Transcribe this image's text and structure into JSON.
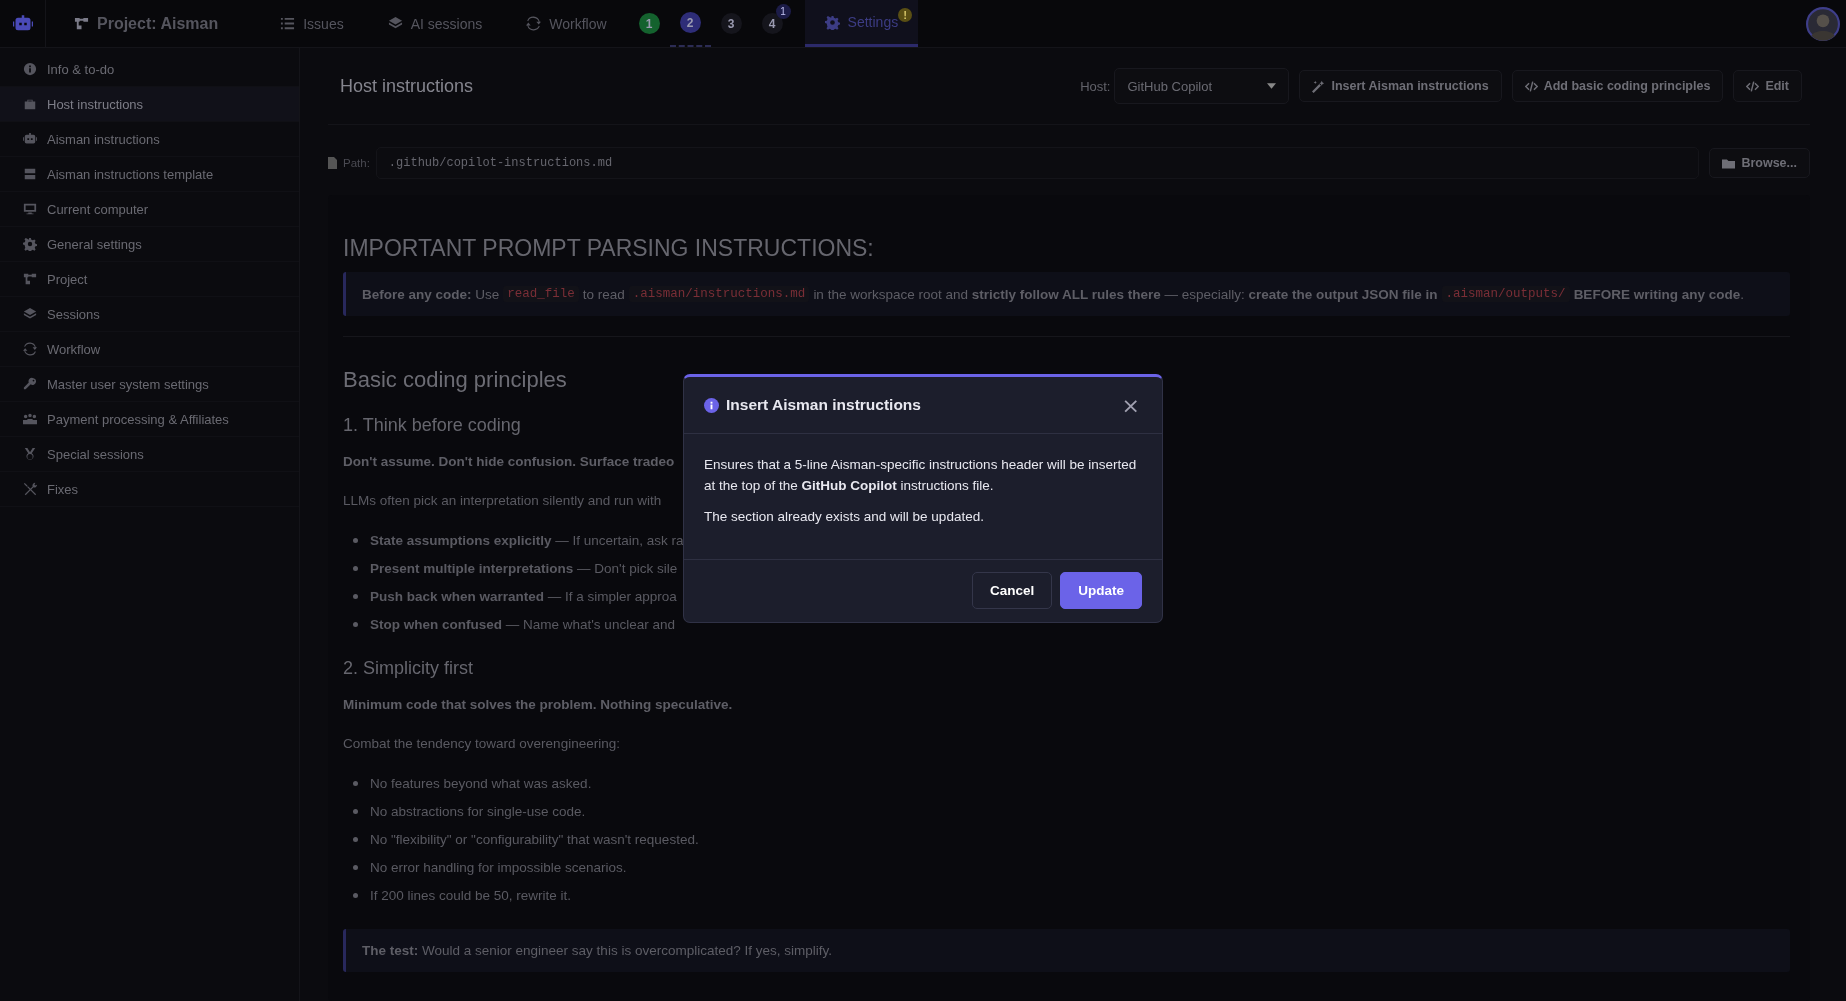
{
  "topbar": {
    "project": "Project: Aisman",
    "tabs": [
      {
        "kind": "tab",
        "label": "Issues",
        "selected": false
      },
      {
        "kind": "tab",
        "label": "AI sessions",
        "selected": false
      },
      {
        "kind": "tab",
        "label": "Workflow",
        "selected": false
      },
      {
        "kind": "slot",
        "label": "1",
        "color": "#14622e",
        "active": false
      },
      {
        "kind": "slot",
        "label": "2",
        "color": "#2e2d78",
        "active": true
      },
      {
        "kind": "slot",
        "label": "3",
        "color": "#15151c",
        "active": false
      },
      {
        "kind": "slot",
        "label": "4",
        "color": "#15151c",
        "active": false,
        "badge": "1"
      },
      {
        "kind": "tab",
        "label": "Settings",
        "selected": true,
        "badge": "!"
      }
    ]
  },
  "sidebar": {
    "items": [
      {
        "label": "Info & to-do",
        "selected": false
      },
      {
        "label": "Host instructions",
        "selected": true
      },
      {
        "label": "Aisman instructions",
        "selected": false
      },
      {
        "label": "Aisman instructions template",
        "selected": false
      },
      {
        "label": "Current computer",
        "selected": false
      },
      {
        "label": "General settings",
        "selected": false
      },
      {
        "label": "Project",
        "selected": false
      },
      {
        "label": "Sessions",
        "selected": false
      },
      {
        "label": "Workflow",
        "selected": false
      },
      {
        "label": "Master user system settings",
        "selected": false
      },
      {
        "label": "Payment processing & Affiliates",
        "selected": false
      },
      {
        "label": "Special sessions",
        "selected": false
      },
      {
        "label": "Fixes",
        "selected": false
      }
    ]
  },
  "header": {
    "title": "Host instructions",
    "host_label": "Host:",
    "host_value": "GitHub Copilot",
    "buttons": [
      "Insert Aisman instructions",
      "Add basic coding principles",
      "Edit"
    ]
  },
  "path": {
    "label": "Path:",
    "value": ".github/copilot-instructions.md",
    "browse": "Browse..."
  },
  "document": [
    {
      "kind": "h1",
      "text": "IMPORTANT PROMPT PARSING INSTRUCTIONS:"
    },
    {
      "kind": "callout",
      "parts": [
        {
          "kind": "text",
          "text": "**Before any code:** Use"
        },
        {
          "kind": "code",
          "text": "read_file"
        },
        {
          "kind": "text",
          "text": "to read"
        },
        {
          "kind": "code",
          "text": ".aisman/instructions.md"
        },
        {
          "kind": "text",
          "text": "in the workspace root and **strictly follow ALL rules there** — especially: **create the output JSON file in**"
        },
        {
          "kind": "code",
          "text": ".aisman/outputs/"
        },
        {
          "kind": "text",
          "text": "**BEFORE writing any code**."
        }
      ]
    },
    {
      "kind": "rule"
    },
    {
      "kind": "h2",
      "text": "Basic coding principles"
    },
    {
      "kind": "h3",
      "text": "1. Think before coding"
    },
    {
      "kind": "lead",
      "text": "Don't assume. Don't hide confusion. Surface tradeo"
    },
    {
      "kind": "p",
      "text": "LLMs often pick an interpretation silently and run with"
    },
    {
      "kind": "ul",
      "items": [
        "**State assumptions explicitly** — If uncertain, ask ra",
        "**Present multiple interpretations** — Don't pick sile",
        "**Push back when warranted** — If a simpler approa",
        "**Stop when confused** — Name what's unclear and"
      ]
    },
    {
      "kind": "h3",
      "text": "2. Simplicity first"
    },
    {
      "kind": "lead",
      "text": "Minimum code that solves the problem. Nothing speculative."
    },
    {
      "kind": "p",
      "text": "Combat the tendency toward overengineering:"
    },
    {
      "kind": "ul",
      "items": [
        "No features beyond what was asked.",
        "No abstractions for single-use code.",
        "No \"flexibility\" or \"configurability\" that wasn't requested.",
        "No error handling for impossible scenarios.",
        "If 200 lines could be 50, rewrite it."
      ]
    },
    {
      "kind": "callout",
      "parts": [
        {
          "kind": "text",
          "text": "**The test:** Would a senior engineer say this is overcomplicated? If yes, simplify."
        }
      ]
    }
  ],
  "modal": {
    "title": "Insert Aisman instructions",
    "close": "×",
    "paragraphs": [
      "Ensures that a 5-line Aisman-specific instructions header will be inserted at the top of the **GitHub Copilot** instructions file.",
      "The section already exists and will be updated."
    ],
    "buttons": [
      {
        "kind": "secondary",
        "label": "Cancel"
      },
      {
        "kind": "primary",
        "label": "Update"
      }
    ]
  }
}
